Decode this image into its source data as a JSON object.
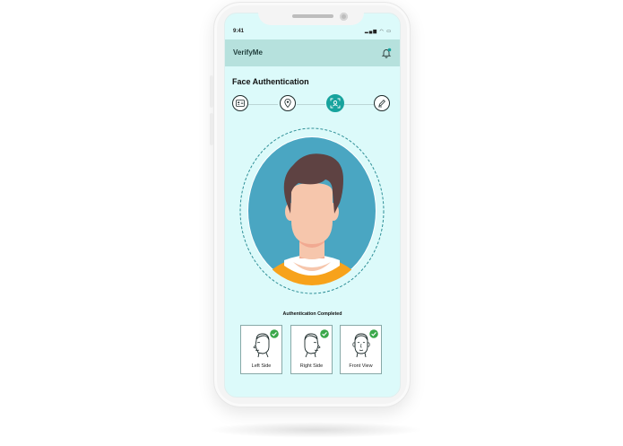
{
  "status_bar": {
    "time": "9:41",
    "icons": "▂▄▆ ◠ ▭"
  },
  "app": {
    "title": "VerifyMe",
    "notification_icon": "bell-icon",
    "notification_dot_color": "#17a39d"
  },
  "page": {
    "title": "Face Authentication"
  },
  "steps": [
    {
      "name": "id-card",
      "icon": "id-card-icon",
      "active": false
    },
    {
      "name": "location",
      "icon": "location-pin-icon",
      "active": false
    },
    {
      "name": "face-scan",
      "icon": "face-scan-icon",
      "active": true
    },
    {
      "name": "signature",
      "icon": "pen-icon",
      "active": false
    }
  ],
  "auth": {
    "status": "Authentication Completed",
    "views": [
      {
        "label": "Left Side",
        "completed": true
      },
      {
        "label": "Right Side",
        "completed": true
      },
      {
        "label": "Front View",
        "completed": true
      }
    ]
  },
  "colors": {
    "accent": "#17a39d",
    "appbar": "#b6e1dd",
    "screen_bg": "#dcfafa",
    "check": "#3aa84a"
  }
}
